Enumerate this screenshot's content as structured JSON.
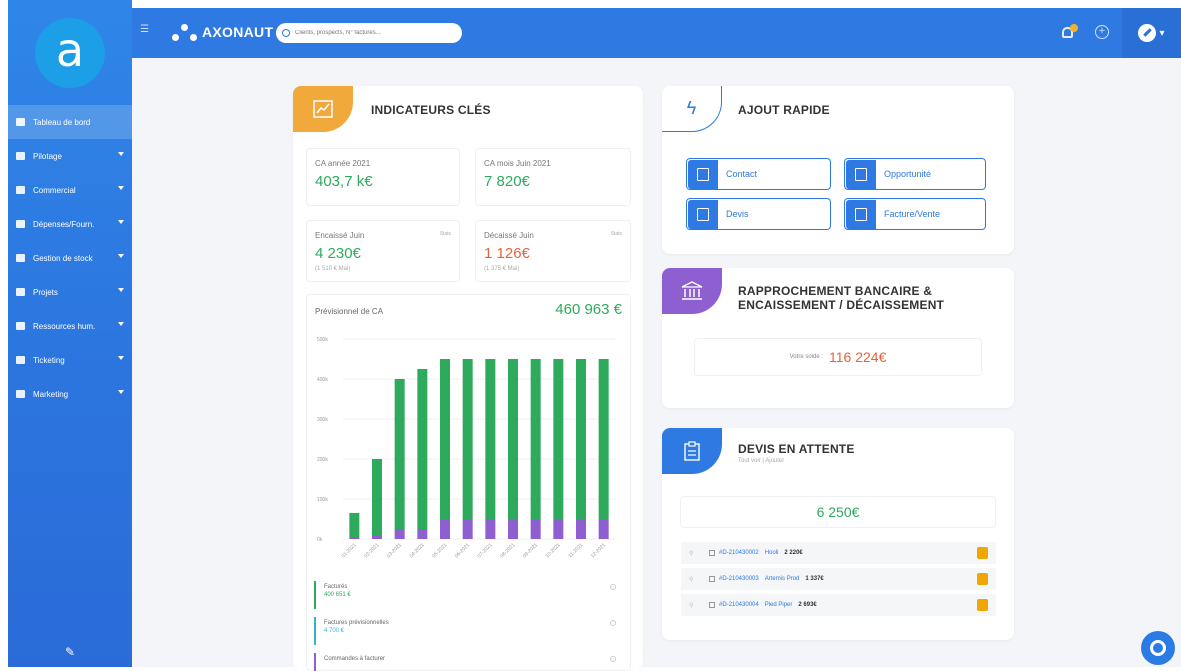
{
  "app": {
    "brand": "AXONAUT",
    "logo_letter": "a"
  },
  "search": {
    "placeholder": "Clients, prospects, N° factures..."
  },
  "sidebar": {
    "items": [
      {
        "label": "Tableau de bord",
        "active": true,
        "chevron": false
      },
      {
        "label": "Pilotage",
        "chevron": true
      },
      {
        "label": "Commercial",
        "chevron": true
      },
      {
        "label": "Dépenses/Fourn.",
        "chevron": true
      },
      {
        "label": "Gestion de stock",
        "chevron": true
      },
      {
        "label": "Projets",
        "chevron": true
      },
      {
        "label": "Ressources hum.",
        "chevron": true
      },
      {
        "label": "Ticketing",
        "chevron": true
      },
      {
        "label": "Marketing",
        "chevron": true
      }
    ]
  },
  "kpi": {
    "title": "INDICATEURS CLÉS",
    "ca_year_label": "CA année 2021",
    "ca_year_value": "403,7 k€",
    "ca_month_label": "CA mois Juin 2021",
    "ca_month_value": "7 820€",
    "enc_label": "Encaissé Juin",
    "enc_value": "4 230€",
    "enc_sub": "(1 510 € Mai)",
    "enc_tag": "Stats",
    "dec_label": "Décaissé Juin",
    "dec_value": "1 126€",
    "dec_sub": "(1 375 € Mai)",
    "dec_tag": "Stats"
  },
  "forecast": {
    "label": "Prévisionnel de CA",
    "value": "460 963 €",
    "legend": [
      {
        "name": "Facturés",
        "value": "400 651 €",
        "color": "#2eaa5d"
      },
      {
        "name": "Factures prévisionnelles",
        "value": "4 700 €",
        "color": "#3bb0c9"
      },
      {
        "name": "Commandes à facturer",
        "value": "",
        "color": "#8e5fd0"
      }
    ]
  },
  "chart_data": {
    "type": "bar",
    "categories": [
      "01-2021",
      "02-2021",
      "03-2021",
      "04-2021",
      "05-2021",
      "06-2021",
      "07-2021",
      "08-2021",
      "09-2021",
      "10-2021",
      "11-2021",
      "12-2021"
    ],
    "series": [
      {
        "name": "Facturés",
        "values": [
          60,
          190,
          375,
          400,
          400,
          400,
          400,
          400,
          400,
          400,
          400,
          400
        ],
        "color": "#2eaa5d"
      },
      {
        "name": "Commandes à facturer",
        "values": [
          5,
          10,
          25,
          25,
          50,
          50,
          50,
          50,
          50,
          50,
          50,
          50
        ],
        "color": "#8e5fd0"
      }
    ],
    "y_ticks": [
      "0k",
      "100k",
      "200k",
      "300k",
      "400k",
      "500k"
    ],
    "ylim": [
      0,
      500
    ],
    "stacked": true
  },
  "quick_add": {
    "title": "AJOUT RAPIDE",
    "buttons": [
      "Contact",
      "Opportunité",
      "Devis",
      "Facture/Vente"
    ]
  },
  "bank": {
    "title_line1": "RAPPROCHEMENT BANCAIRE &",
    "title_line2": "ENCAISSEMENT / DÉCAISSEMENT",
    "balance_label": "Votre solde :",
    "balance_value": "116 224€"
  },
  "quotes": {
    "title": "DEVIS EN ATTENTE",
    "subtitle": "Tout voir | Ajouter",
    "total": "6 250€",
    "rows": [
      {
        "ref": "#D-210430002",
        "client": "Hooli",
        "amount": "2 220€"
      },
      {
        "ref": "#D-210430003",
        "client": "Artemis Prod",
        "amount": "1 337€"
      },
      {
        "ref": "#D-210430004",
        "client": "Pied Piper",
        "amount": "2 693€"
      }
    ]
  },
  "colors": {
    "primary": "#2e79e2",
    "green": "#2eaa5d",
    "orange": "#e2643a",
    "purple": "#8e5fd0",
    "kpi_badge": "#f0a93a"
  }
}
